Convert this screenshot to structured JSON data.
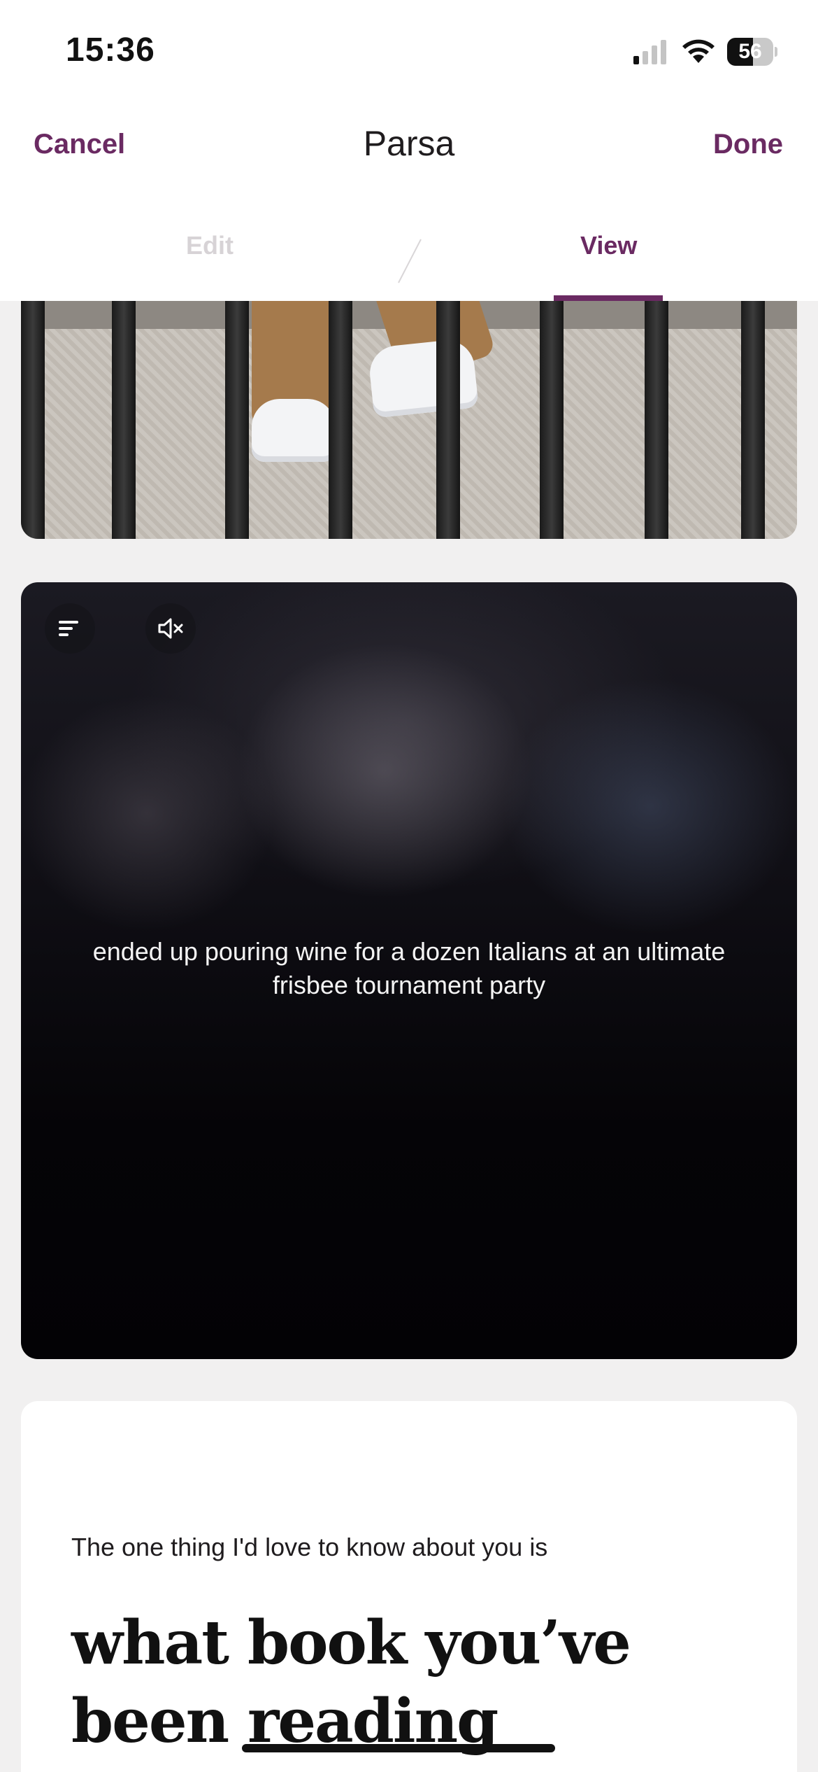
{
  "status_bar": {
    "time": "15:36",
    "battery": "56",
    "battery_level": 0.56,
    "signal_bars_active": 1,
    "icons": [
      "signal-icon",
      "wifi-icon",
      "battery-icon"
    ]
  },
  "nav": {
    "cancel_label": "Cancel",
    "title": "Parsa",
    "done_label": "Done"
  },
  "tabs": [
    {
      "label": "Edit",
      "active": false
    },
    {
      "label": "View",
      "active": true
    }
  ],
  "photo": {
    "subject": "person-in-tan-trousers-and-white-sneakers-behind-railings"
  },
  "video": {
    "caption": "ended up pouring wine for a dozen Italians at an ultimate frisbee tournament party",
    "controls": [
      "captions-icon",
      "mute-icon"
    ]
  },
  "prompt": {
    "question": "The one thing I'd love to know about you is",
    "answer": "what book you’ve been reading recently"
  },
  "colors": {
    "accent": "#6a2a62",
    "background": "#f1f0f0",
    "inactive_tab": "#d7d3d6"
  }
}
